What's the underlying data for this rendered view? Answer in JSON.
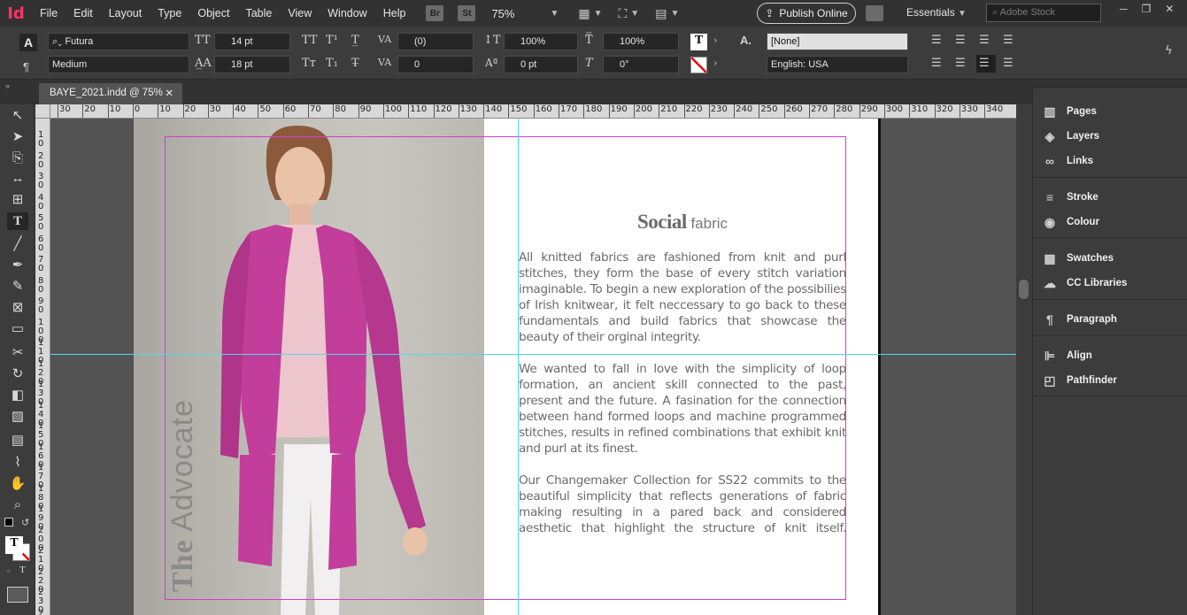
{
  "app": {
    "logo": "Id"
  },
  "menu": [
    "File",
    "Edit",
    "Layout",
    "Type",
    "Object",
    "Table",
    "View",
    "Window",
    "Help"
  ],
  "bridge": "Br",
  "stock_btn": "St",
  "zoom": "75%",
  "publish": "Publish Online",
  "workspace": "Essentials",
  "search": {
    "placeholder": "Adobe Stock"
  },
  "control": {
    "font_family": "Futura",
    "font_style": "Medium",
    "font_size": "14 pt",
    "leading": "18 pt",
    "kerning": "(0)",
    "tracking": "0",
    "v_scale": "100%",
    "h_scale": "100%",
    "baseline": "0 pt",
    "skew": "0°",
    "char_style": "[None]",
    "language": "English: USA"
  },
  "document": {
    "tab": "BAYE_2021.indd @ 75%"
  },
  "ruler_h": [
    "30",
    "20",
    "10",
    "0",
    "10",
    "20",
    "30",
    "40",
    "50",
    "60",
    "70",
    "80",
    "90",
    "100",
    "110",
    "120",
    "130",
    "140",
    "150",
    "160",
    "170",
    "180",
    "190",
    "200",
    "210",
    "220",
    "230",
    "240",
    "250",
    "260",
    "270",
    "280",
    "290",
    "300",
    "310",
    "320",
    "330",
    "340"
  ],
  "ruler_v": [
    "1 0",
    "2 0",
    "3 0",
    "4 0",
    "5 0",
    "6 0",
    "7 0",
    "8 0",
    "9 0",
    "1 0 0",
    "1 1 0",
    "1 2 0",
    "1 3 0",
    "1 4 0",
    "1 5 0",
    "1 6 0",
    "1 7 0",
    "1 8 0",
    "1 9 0",
    "2 0 0",
    "2 1 0",
    "2 2 0",
    "2 3 0",
    "2 4 0"
  ],
  "layout": {
    "vertical_title_bold": "The",
    "vertical_title": " Advocate",
    "heading_bold": "Social",
    "heading_rest": " fabric",
    "paragraphs": [
      "All knitted fabrics are fashioned from knit and purl stitches, they form the base of every stitch variation imaginable. To begin a new exploration of the possibilies of Irish knitwear, it felt neccessary to go back to these fundamentals and build fabrics that showcase the beauty of their orginal integrity.",
      "We wanted to fall in love with the simplicity of loop formation, an ancient skill connected to the past, present and the future. A fasination for the connection between hand formed loops and machine programmed stitches, results in refined combinations that exhibit knit and purl at its finest.",
      "Our Changemaker Collection for SS22 commits to the beautiful simplicity that reflects generations of fabric making resulting in a pared back and considered aesthetic that highlight the structure of knit itself."
    ]
  },
  "panels": [
    "Pages",
    "Layers",
    "Links",
    "Stroke",
    "Colour",
    "Swatches",
    "CC Libraries",
    "Paragraph",
    "Align",
    "Pathfinder"
  ],
  "colors": {
    "accent": "#ff3366",
    "margin": "#d13dd1",
    "guide": "#4fd9e8",
    "cardigan": "#c23e9a"
  }
}
